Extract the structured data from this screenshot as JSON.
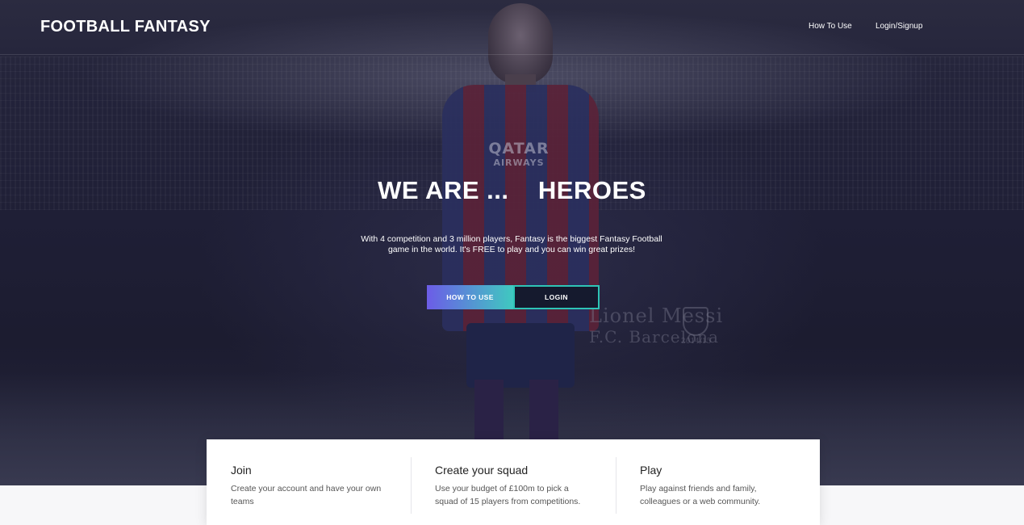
{
  "navbar": {
    "brand": "FOOTBALL FANTASY",
    "links": [
      "How To Use",
      "Login/Signup"
    ]
  },
  "hero": {
    "headline": "WE ARE ...    HEROES",
    "tagline": "With 4 competition and 3 million players, Fantasy is the biggest Fantasy Football game in the world. It's FREE to play and you can win great prizes!",
    "buttons": {
      "how_to_use": "How To Use",
      "login": "Login"
    },
    "image_text": {
      "sponsor_main": "QATAR",
      "sponsor_sub": "AIRWAYS",
      "watermark_name": "Lionel Messi",
      "watermark_club": "F.C. Barcelona",
      "watermark_season": "2014/15"
    }
  },
  "features": [
    {
      "title": "Join",
      "text": "Create your account and have your own teams"
    },
    {
      "title": "Create your squad",
      "text": "Use your budget of £100m to pick a squad of 15 players from competitions."
    },
    {
      "title": "Play",
      "text": "Play against friends and family, colleagues or a web community."
    }
  ],
  "colors": {
    "hero_bg": "#1f1f36",
    "btn_gradient_start": "#6c5ce7",
    "btn_gradient_end": "#3fc9c0",
    "btn_outline": "#2ec4b6"
  }
}
